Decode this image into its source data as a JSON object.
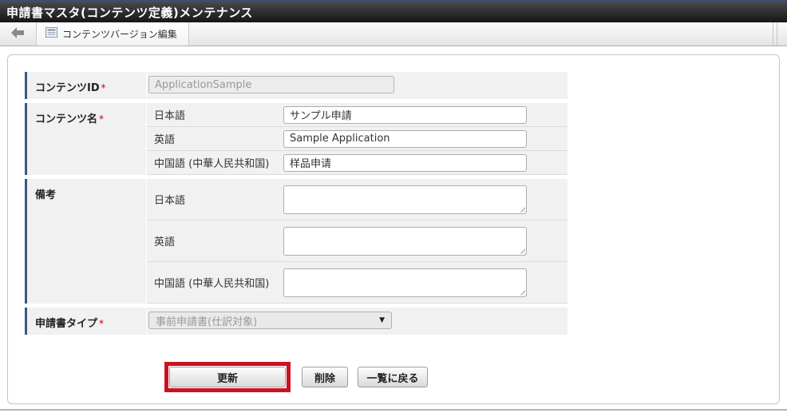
{
  "titlebar": {
    "title": "申請書マスタ(コンテンツ定義)メンテナンス"
  },
  "toolbar": {
    "back_icon": "back-arrow-icon",
    "tab": {
      "icon": "document-list-icon",
      "label": "コンテンツバージョン編集"
    }
  },
  "form": {
    "content_id": {
      "label": "コンテンツID",
      "required_mark": "*",
      "value": "ApplicationSample"
    },
    "content_name": {
      "label": "コンテンツ名",
      "required_mark": "*",
      "ja": {
        "label": "日本語",
        "value": "サンプル申請"
      },
      "en": {
        "label": "英語",
        "value": "Sample Application"
      },
      "zh": {
        "label": "中国語 (中華人民共和国)",
        "value": "样品申请"
      }
    },
    "remarks": {
      "label": "備考",
      "ja": {
        "label": "日本語",
        "value": ""
      },
      "en": {
        "label": "英語",
        "value": ""
      },
      "zh": {
        "label": "中国語 (中華人民共和国)",
        "value": ""
      }
    },
    "app_type": {
      "label": "申請書タイプ",
      "required_mark": "*",
      "selected": "事前申請書(仕訳対象)",
      "caret": "▼"
    }
  },
  "buttons": {
    "update": "更新",
    "delete": "削除",
    "back_to_list": "一覧に戻る"
  },
  "colors": {
    "accent_row_border": "#3b5780",
    "required": "#cc0000",
    "annotation_highlight": "#cc1122",
    "titlebar_top_edge": "#3d4e6e"
  }
}
